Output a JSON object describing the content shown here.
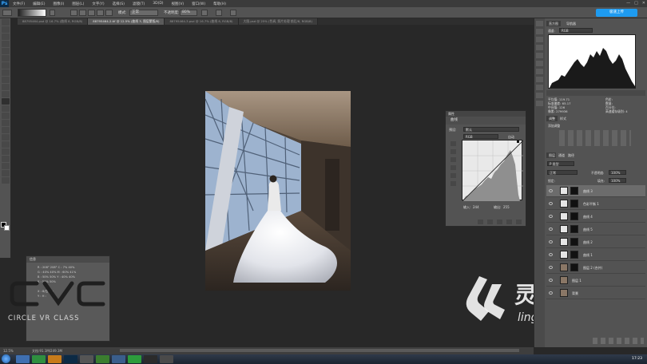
{
  "menubar": {
    "logo": "Ps",
    "items": [
      "文件(F)",
      "编辑(E)",
      "图像(I)",
      "图层(L)",
      "文字(Y)",
      "选择(S)",
      "滤镜(T)",
      "3D(D)",
      "视图(V)",
      "窗口(W)",
      "帮助(H)"
    ],
    "window_controls": [
      "—",
      "□",
      "✕"
    ]
  },
  "options": {
    "mode_label": "模式:",
    "mode_value": "正常",
    "opacity_label": "不透明度:",
    "opacity_value": "80%",
    "upload_label": "极速上传"
  },
  "tabs": [
    {
      "label": "88795464.psd @ 16.7% (曲线 8, RGB/8)",
      "active": false
    },
    {
      "label": "88795464-2.tif @ 12.5% (曲线 3, 图层蒙版/8)",
      "active": true
    },
    {
      "label": "88795464-3.psd @ 16.7% (曲线 8, RGB/8)",
      "active": false
    },
    {
      "label": "大图.psd @ 25% (色调, 照片处理 前后/8, RGB/8)",
      "active": false
    }
  ],
  "curves_panel": {
    "title": "属性",
    "header": "曲线",
    "preset_label": "预设:",
    "preset_value": "默认",
    "channel_value": "RGB",
    "auto_label": "自动",
    "input_label": "输入:",
    "input_value": "244",
    "output_label": "输出:",
    "output_value": "255"
  },
  "info_panel": {
    "title": "信息",
    "lines": [
      "R : 208° 208°   C : 7% 40%",
      "G : 40% 40%   M : 60% 41%",
      "B : 50% 50%   Y : 40% 40%",
      "K : 50% 50%",
      "X : 8/位   W :",
      "Y :   H :"
    ]
  },
  "logo": {
    "mark": "CVC",
    "text": "CIRCLE VR CLASS"
  },
  "watermark": {
    "cn": "灵感中国",
    "en": "lingganchina.com"
  },
  "histogram_panel": {
    "tabs": [
      "直方图",
      "导航器"
    ],
    "channel_label": "通道:",
    "channel_value": "RGB",
    "stats_left": [
      "平均值: 119.71",
      "标准偏差: 65.17",
      "中间值: 126",
      "像素: 279936"
    ],
    "stats_right": [
      "色阶:",
      "数量:",
      "百分位:",
      "高速缓存级别: 4"
    ]
  },
  "adjust_panel": {
    "tabs": [
      "调整",
      "样式"
    ],
    "add_label": "添加调整"
  },
  "layers_panel": {
    "tabs": [
      "图层",
      "通道",
      "路径"
    ],
    "kind_label": "P 类型",
    "blend_value": "正常",
    "opacity_label": "不透明度:",
    "opacity_value": "100%",
    "lock_label": "锁定:",
    "fill_label": "填充:",
    "fill_value": "100%",
    "layers": [
      {
        "name": "曲线 3",
        "selected": true
      },
      {
        "name": "色彩平衡 1",
        "selected": false
      },
      {
        "name": "曲线 4",
        "selected": false
      },
      {
        "name": "曲线 5",
        "selected": false
      },
      {
        "name": "曲线 2",
        "selected": false
      },
      {
        "name": "曲线 1",
        "selected": false
      },
      {
        "name": "图层 2 (合并)",
        "selected": false
      },
      {
        "name": "图层 1",
        "selected": false
      },
      {
        "name": "背景",
        "selected": false
      }
    ]
  },
  "status": {
    "zoom": "12.5%",
    "doc": "文档:91.1M/249.3M"
  },
  "taskbar": {
    "clock": "17:23"
  },
  "colors": {
    "accent": "#1e9bf0",
    "panel": "#535353",
    "canvas_bg": "#282828"
  }
}
